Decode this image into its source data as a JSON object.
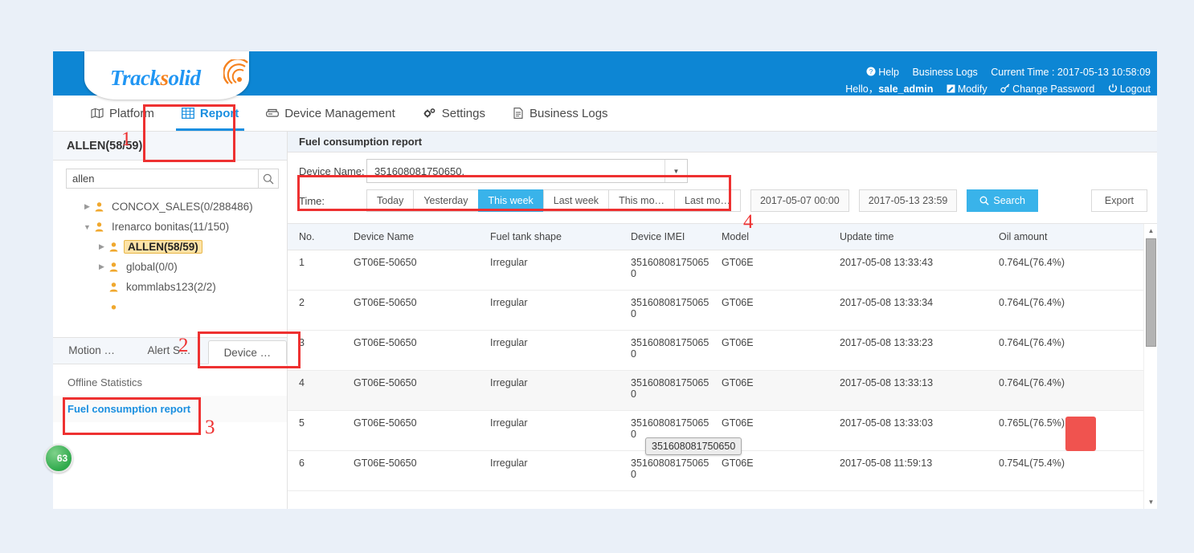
{
  "header": {
    "logo_track": "Track",
    "logo_s": "s",
    "logo_olid": "olid",
    "help": "Help",
    "business_logs": "Business Logs",
    "current_time": "Current Time : 2017-05-13 10:58:09",
    "hello": "Hello，",
    "user": "sale_admin",
    "modify": "Modify",
    "change_password": "Change Password",
    "logout": "Logout"
  },
  "nav": {
    "items": [
      {
        "label": "Platform",
        "icon": "map-icon",
        "active": false
      },
      {
        "label": "Report",
        "icon": "grid-icon",
        "active": true
      },
      {
        "label": "Device Management",
        "icon": "device-icon",
        "active": false
      },
      {
        "label": "Settings",
        "icon": "gears-icon",
        "active": false
      },
      {
        "label": "Business Logs",
        "icon": "document-icon",
        "active": false
      }
    ]
  },
  "sidebar": {
    "title": "ALLEN(58/59)",
    "search_value": "allen",
    "search_placeholder": "",
    "tree": [
      {
        "label": "CONCOX_SALES(0/288486)",
        "indent": 0,
        "caret": "right",
        "selected": false
      },
      {
        "label": "Irenarco bonitas(11/150)",
        "indent": 0,
        "caret": "down",
        "selected": false
      },
      {
        "label": "ALLEN(58/59)",
        "indent": 1,
        "caret": "right",
        "selected": true
      },
      {
        "label": "global(0/0)",
        "indent": 1,
        "caret": "right",
        "selected": false
      },
      {
        "label": "kommlabs123(2/2)",
        "indent": 1,
        "caret": "none",
        "selected": false
      }
    ],
    "tabs": [
      {
        "label": "Motion …",
        "active": false
      },
      {
        "label": "Alert S…",
        "active": false
      },
      {
        "label": "Device …",
        "active": true
      }
    ],
    "list": [
      {
        "label": "Offline Statistics",
        "link": false
      },
      {
        "label": "Fuel consumption report",
        "link": true
      }
    ],
    "badge": "63"
  },
  "main": {
    "title": "Fuel consumption report",
    "device_name_label": "Device Name:",
    "device_name_value": "351608081750650,",
    "time_label": "Time:",
    "time_buttons": [
      {
        "label": "Today",
        "active": false
      },
      {
        "label": "Yesterday",
        "active": false
      },
      {
        "label": "This week",
        "active": true
      },
      {
        "label": "Last week",
        "active": false
      },
      {
        "label": "This mo…",
        "active": false
      },
      {
        "label": "Last mo…",
        "active": false
      }
    ],
    "date_from": "2017-05-07 00:00",
    "date_to": "2017-05-13 23:59",
    "search_button": "Search",
    "export_button": "Export",
    "columns": [
      "No.",
      "Device Name",
      "Fuel tank shape",
      "Device IMEI",
      "Model",
      "Update time",
      "Oil amount"
    ],
    "rows": [
      {
        "no": "1",
        "device_name": "GT06E-50650",
        "shape": "Irregular",
        "imei": "351608081750650",
        "model": "GT06E",
        "update_time": "2017-05-08 13:33:43",
        "oil": "0.764L(76.4%)",
        "hover": false
      },
      {
        "no": "2",
        "device_name": "GT06E-50650",
        "shape": "Irregular",
        "imei": "351608081750650",
        "model": "GT06E",
        "update_time": "2017-05-08 13:33:34",
        "oil": "0.764L(76.4%)",
        "hover": false
      },
      {
        "no": "3",
        "device_name": "GT06E-50650",
        "shape": "Irregular",
        "imei": "351608081750650",
        "model": "GT06E",
        "update_time": "2017-05-08 13:33:23",
        "oil": "0.764L(76.4%)",
        "hover": false
      },
      {
        "no": "4",
        "device_name": "GT06E-50650",
        "shape": "Irregular",
        "imei": "351608081750650",
        "model": "GT06E",
        "update_time": "2017-05-08 13:33:13",
        "oil": "0.764L(76.4%)",
        "hover": true
      },
      {
        "no": "5",
        "device_name": "GT06E-50650",
        "shape": "Irregular",
        "imei": "351608081750650",
        "model": "GT06E",
        "update_time": "2017-05-08 13:33:03",
        "oil": "0.765L(76.5%)",
        "hover": false
      },
      {
        "no": "6",
        "device_name": "GT06E-50650",
        "shape": "Irregular",
        "imei": "351608081750650",
        "model": "GT06E",
        "update_time": "2017-05-08 11:59:13",
        "oil": "0.754L(75.4%)",
        "hover": false
      }
    ],
    "tooltip": "351608081750650"
  },
  "annotations": {
    "numbers": [
      "1",
      "2",
      "3",
      "4"
    ],
    "color": "#ee3131"
  }
}
